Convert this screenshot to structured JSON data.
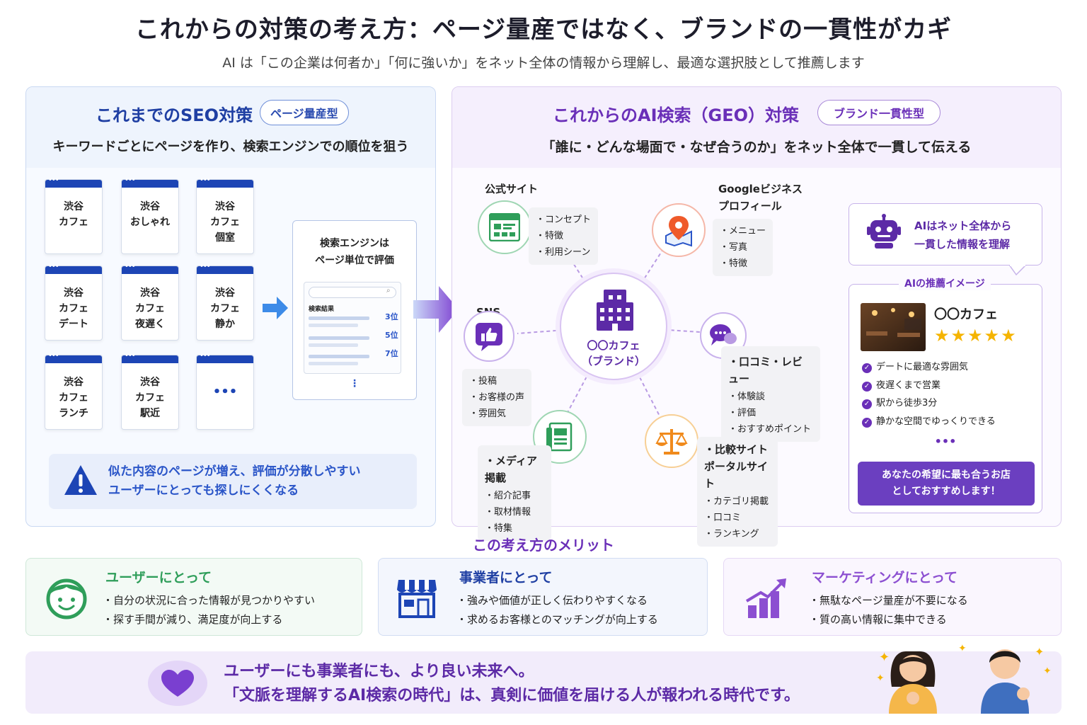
{
  "title": "これからの対策の考え方：ページ量産ではなく、ブランドの一貫性がカギ",
  "subtitle": "AI は「この企業は何者か」「何に強いか」をネット全体の情報から理解し、最適な選択肢として推薦します",
  "left_panel": {
    "title": "これまでのSEO対策",
    "badge": "ページ量産型",
    "description": "キーワードごとにページを作り、検索エンジンでの順位を狙う",
    "cards": [
      "渋谷\nカフェ",
      "渋谷\nおしゃれ",
      "渋谷\nカフェ\n個室",
      "渋谷\nカフェ\nデート",
      "渋谷\nカフェ\n夜遅く",
      "渋谷\nカフェ\n静か",
      "渋谷\nカフェ\nランチ",
      "渋谷\nカフェ\n駅近",
      "•••"
    ],
    "search_box": {
      "title": "検索エンジンは\nページ単位で評価",
      "results_label": "検索結果",
      "ranks": [
        "3位",
        "5位",
        "7位"
      ],
      "more": "⋮"
    },
    "warning": "似た内容のページが増え、評価が分散しやすい\nユーザーにとっても探しにくくなる"
  },
  "right_panel": {
    "title": "これからのAI検索（GEO）対策",
    "badge": "ブランド一貫性型",
    "description": "「誰に・どんな場面で・なぜ合うのか」をネット全体で一貫して伝える",
    "hub": "〇〇カフェ\n（ブランド）",
    "nodes": {
      "official": {
        "label": "公式サイト",
        "items": [
          "コンセプト",
          "特徴",
          "利用シーン"
        ]
      },
      "google": {
        "label": "Googleビジネス\nプロフィール",
        "items": [
          "メニュー",
          "写真",
          "特徴"
        ]
      },
      "sns": {
        "label": "SNS",
        "items": [
          "投稿",
          "お客様の声",
          "雰囲気"
        ]
      },
      "reviews": {
        "label": "口コミ・レビュー",
        "items": [
          "体験談",
          "評価",
          "おすすめポイント"
        ]
      },
      "media": {
        "label": "メディア掲載",
        "items": [
          "紹介記事",
          "取材情報",
          "特集"
        ]
      },
      "portal": {
        "label": "比較サイト\nポータルサイト",
        "items": [
          "カテゴリ掲載",
          "口コミ",
          "ランキング"
        ]
      }
    },
    "ai_bubble": "AIはネット全体から\n一貫した情報を理解",
    "recommendation": {
      "title": "AIの推薦イメージ",
      "name": "〇〇カフェ",
      "stars": "★★★★★",
      "rating": 5,
      "points": [
        "デートに最適な雰囲気",
        "夜遅くまで営業",
        "駅から徒歩3分",
        "静かな空間でゆっくりできる"
      ],
      "more": "•••",
      "button": "あなたの希望に最も合うお店\nとしておすすめします！"
    }
  },
  "merits": {
    "title": "この考え方のメリット",
    "items": [
      {
        "title": "ユーザーにとって",
        "lines": [
          "自分の状況に合った情報が見つかりやすい",
          "探す手間が減り、満足度が向上する"
        ]
      },
      {
        "title": "事業者にとって",
        "lines": [
          "強みや価値が正しく伝わりやすくなる",
          "求めるお客様とのマッチングが向上する"
        ]
      },
      {
        "title": "マーケティングにとって",
        "lines": [
          "無駄なページ量産が不要になる",
          "質の高い情報に集中できる"
        ]
      }
    ]
  },
  "footer": "ユーザーにも事業者にも、より良い未来へ。\n「文脈を理解するAI検索の時代」は、真剣に価値を届ける人が報われる時代です。",
  "colors": {
    "blue": "#1f3fa3",
    "purple": "#6a2fb8",
    "green": "#2f9e5a",
    "orange": "#f08a1c"
  }
}
